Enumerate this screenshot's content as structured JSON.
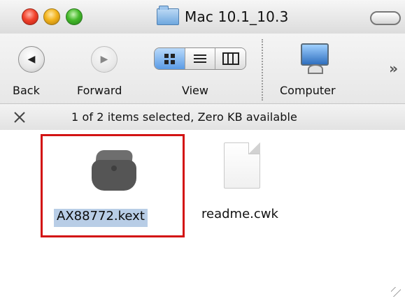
{
  "window": {
    "title": "Mac 10.1_10.3"
  },
  "toolbar": {
    "back_label": "Back",
    "forward_label": "Forward",
    "view_label": "View",
    "computer_label": "Computer",
    "overflow_symbol": "»",
    "back_icon": "back-icon",
    "forward_icon": "forward-icon",
    "view_icons": [
      "icon-view",
      "list-view",
      "column-view"
    ],
    "computer_icon": "computer-icon"
  },
  "status": {
    "text": "1 of 2 items selected, Zero KB available",
    "icon": "pencil-disabled-icon"
  },
  "files": [
    {
      "name": "AX88772.kext",
      "icon": "kext-bundle-icon",
      "selected": true
    },
    {
      "name": "readme.cwk",
      "icon": "document-icon",
      "selected": false
    }
  ],
  "colors": {
    "selection_highlight": "#b8cde6",
    "annotation_border": "#d31313"
  }
}
